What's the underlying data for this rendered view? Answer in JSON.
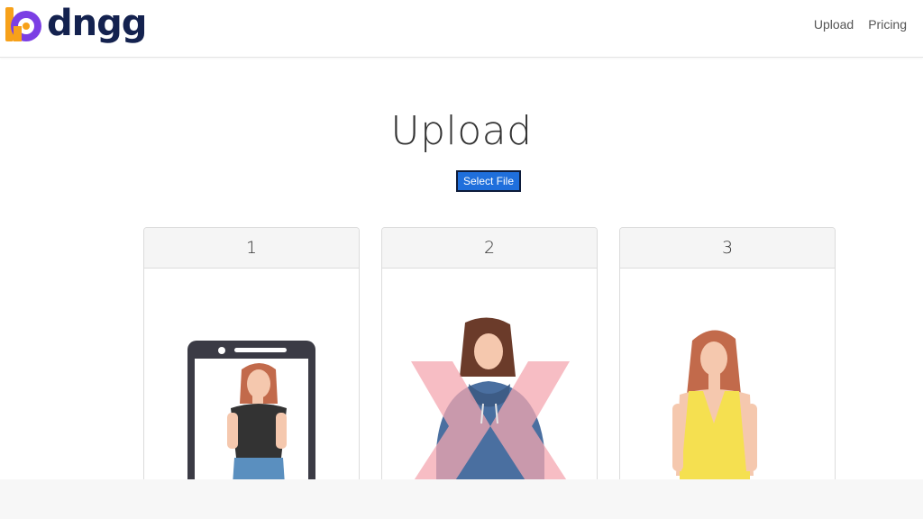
{
  "brand": {
    "name": "dngg"
  },
  "nav": {
    "items": [
      {
        "label": "Upload"
      },
      {
        "label": "Pricing"
      }
    ]
  },
  "main": {
    "title": "Upload",
    "select_file_label": "Select File",
    "cards": [
      {
        "number": "1",
        "icon": "phone-selfie-illustration"
      },
      {
        "number": "2",
        "icon": "person-hoodie-illustration"
      },
      {
        "number": "3",
        "icon": "person-tank-top-illustration"
      }
    ]
  },
  "colors": {
    "brand_text": "#14224f",
    "logo_orange": "#f7a11a",
    "logo_purple": "#7b3fe4",
    "button": "#1f6fdc"
  }
}
